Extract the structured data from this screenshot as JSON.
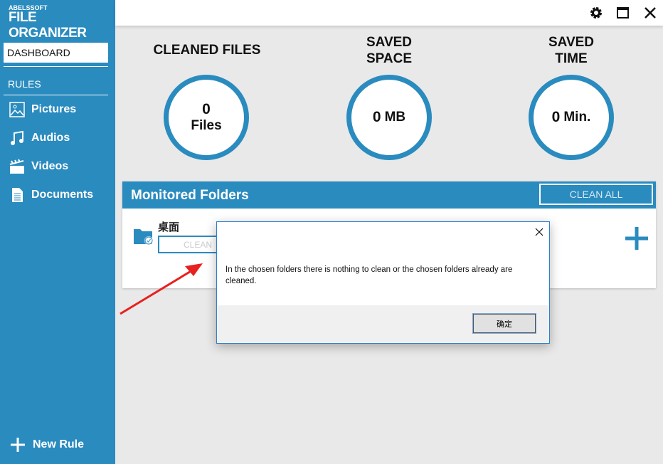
{
  "app": {
    "brand_small": "ABELSSOFT",
    "brand_name": "FILE ORGANIZER"
  },
  "sidebar": {
    "dashboard": "DASHBOARD",
    "rules_heading": "RULES",
    "items": [
      {
        "label": "Pictures",
        "icon": "picture-icon"
      },
      {
        "label": "Audios",
        "icon": "music-icon"
      },
      {
        "label": "Videos",
        "icon": "clapperboard-icon"
      },
      {
        "label": "Documents",
        "icon": "document-icon"
      }
    ],
    "new_rule": "New Rule"
  },
  "stats": [
    {
      "title": "CLEANED FILES",
      "value": "0",
      "unit": "Files"
    },
    {
      "title": "SAVED\nSPACE",
      "value": "0",
      "unit": "MB"
    },
    {
      "title": "SAVED\nTIME",
      "value": "0",
      "unit": "Min."
    }
  ],
  "panel": {
    "title": "Monitored Folders",
    "clean_all": "CLEAN ALL",
    "folders": [
      {
        "name": "桌面",
        "clean": "CLEAN"
      }
    ]
  },
  "dialog": {
    "message": "In the chosen folders there is nothing to clean or the chosen folders already are cleaned.",
    "ok": "确定"
  },
  "colors": {
    "accent": "#2a8bbf"
  }
}
